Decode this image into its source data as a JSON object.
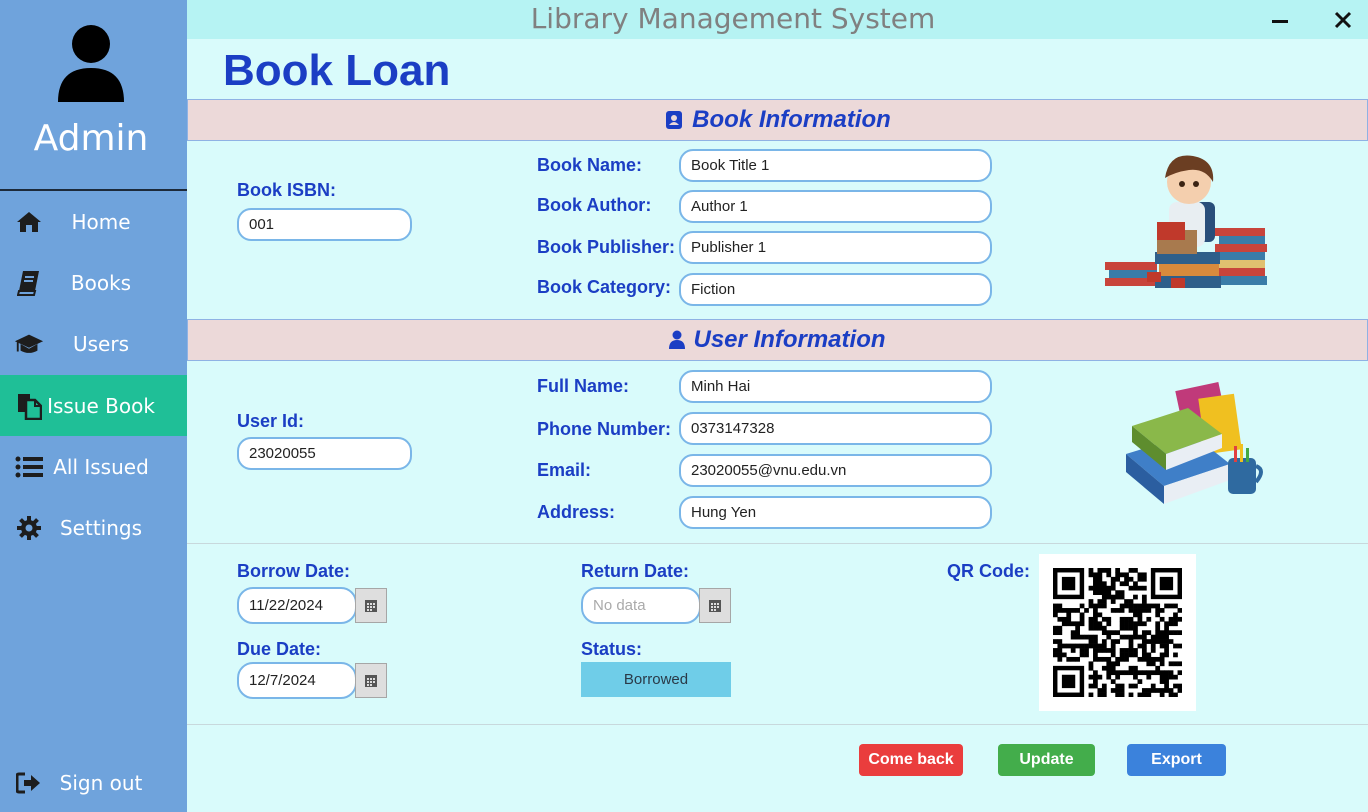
{
  "app": {
    "window_title": "Library Management System"
  },
  "sidebar": {
    "user_label": "Admin",
    "items": [
      {
        "label": "Home",
        "icon": "home-icon"
      },
      {
        "label": "Books",
        "icon": "book-icon"
      },
      {
        "label": "Users",
        "icon": "graduation-cap-icon"
      },
      {
        "label": "Issue Book",
        "icon": "copy-document-icon",
        "active": true
      },
      {
        "label": "All Issued",
        "icon": "list-icon"
      },
      {
        "label": "Settings",
        "icon": "gear-icon"
      }
    ],
    "sign_out": {
      "label": "Sign out",
      "icon": "sign-out-icon"
    }
  },
  "page": {
    "title": "Book Loan"
  },
  "book_section": {
    "heading": "Book Information",
    "isbn_label": "Book ISBN:",
    "isbn_value": "001",
    "name_label": "Book Name:",
    "name_value": "Book Title 1",
    "author_label": "Book Author:",
    "author_value": "Author 1",
    "publisher_label": "Book Publisher:",
    "publisher_value": "Publisher 1",
    "category_label": "Book Category:",
    "category_value": "Fiction"
  },
  "user_section": {
    "heading": "User Information",
    "id_label": "User Id:",
    "id_value": "23020055",
    "fullname_label": "Full Name:",
    "fullname_value": "Minh Hai",
    "phone_label": "Phone Number:",
    "phone_value": "0373147328",
    "email_label": "Email:",
    "email_value": "23020055@vnu.edu.vn",
    "address_label": "Address:",
    "address_value": "Hung Yen"
  },
  "loan": {
    "borrow_label": "Borrow Date:",
    "borrow_value": "11/22/2024",
    "due_label": "Due Date:",
    "due_value": "12/7/2024",
    "return_label": "Return Date:",
    "return_placeholder": "No data",
    "status_label": "Status:",
    "status_value": "Borrowed",
    "qr_label": "QR Code:"
  },
  "actions": {
    "come_back": "Come back",
    "update": "Update",
    "export": "Export"
  },
  "colors": {
    "sidebar": "#6fa3dc",
    "active": "#1fbf97",
    "accent_text": "#1b3ec4",
    "come_back": "#ea3d3d",
    "update": "#43ad4b",
    "export": "#3b82dc"
  }
}
